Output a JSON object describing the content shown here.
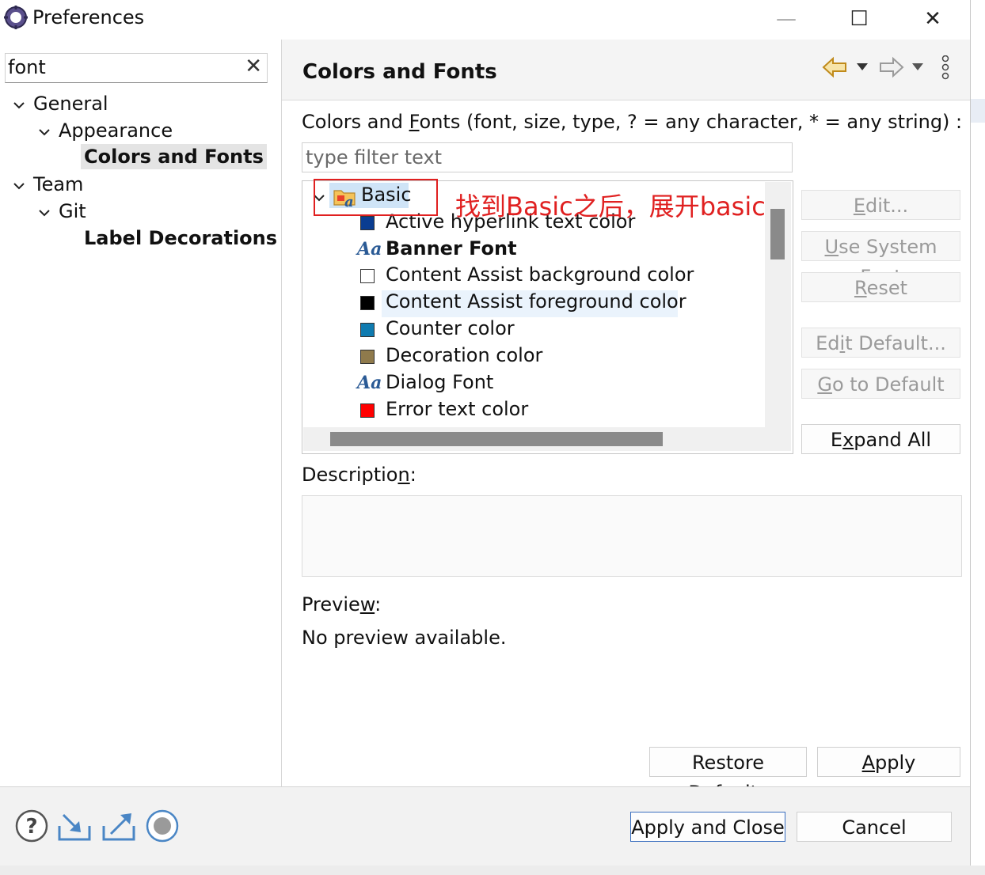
{
  "window": {
    "title": "Preferences",
    "minimize_glyph": "—",
    "maximize_glyph": "☐",
    "close_glyph": "✕"
  },
  "sidebar": {
    "filter_value": "font",
    "clear_glyph": "✕",
    "tree": [
      {
        "label": "General"
      },
      {
        "label": "Appearance"
      },
      {
        "label": "Colors and Fonts"
      },
      {
        "label": "Team"
      },
      {
        "label": "Git"
      },
      {
        "label": "Label Decorations"
      }
    ]
  },
  "page": {
    "title": "Colors and Fonts",
    "toolbar_icons": [
      "back-arrow-icon",
      "dropdown-icon",
      "forward-arrow-icon",
      "dropdown-icon",
      "more-vertical-icon"
    ],
    "label_pre": "Colors and ",
    "label_mn": "F",
    "label_post": "onts (font, size, type, ? = any character, * = any string) :",
    "filter_placeholder": "type filter text",
    "tree_root": "Basic",
    "items": [
      {
        "kind": "color",
        "label": "Active hyperlink text color",
        "color": "#0a3d91",
        "bold": false
      },
      {
        "kind": "font",
        "label": "Banner Font",
        "bold": true
      },
      {
        "kind": "color",
        "label": "Content Assist background color",
        "color": "#ffffff",
        "bold": false
      },
      {
        "kind": "color",
        "label": "Content Assist foreground color",
        "color": "#000000",
        "bold": false
      },
      {
        "kind": "color",
        "label": "Counter color",
        "color": "#0f7bb0",
        "bold": false
      },
      {
        "kind": "color",
        "label": "Decoration color",
        "color": "#8f7a4c",
        "bold": false
      },
      {
        "kind": "font",
        "label": "Dialog Font",
        "bold": false
      },
      {
        "kind": "color",
        "label": "Error text color",
        "color": "#ff0000",
        "bold": false
      }
    ],
    "font_glyph": "Aa",
    "buttons": {
      "edit": {
        "mn": "E",
        "rest": "dit..."
      },
      "use_system_font": {
        "mn": "U",
        "rest": "se System Font"
      },
      "reset": {
        "mn": "R",
        "rest": "eset"
      },
      "edit_default": {
        "pre": "Ed",
        "mn": "i",
        "rest": "t Default..."
      },
      "go_to_default": {
        "mn": "G",
        "rest": "o to Default"
      },
      "expand_all": {
        "pre": "E",
        "mn": "x",
        "rest": "pand All"
      }
    },
    "description_pre": "Descriptio",
    "description_mn": "n",
    "description_post": ":",
    "preview_pre": "Previe",
    "preview_mn": "w",
    "preview_post": ":",
    "preview_text": "No preview available.",
    "restore_defaults": {
      "pre": "Restore ",
      "mn": "D",
      "rest": "efaults"
    },
    "apply": {
      "mn": "A",
      "rest": "pply"
    }
  },
  "footer": {
    "icons": [
      "help-icon",
      "import-icon",
      "export-icon",
      "record-icon"
    ],
    "apply_and_close": "Apply and Close",
    "cancel": "Cancel"
  },
  "annotation": {
    "text": "找到Basic之后，展开basic",
    "color": "#e02020"
  }
}
